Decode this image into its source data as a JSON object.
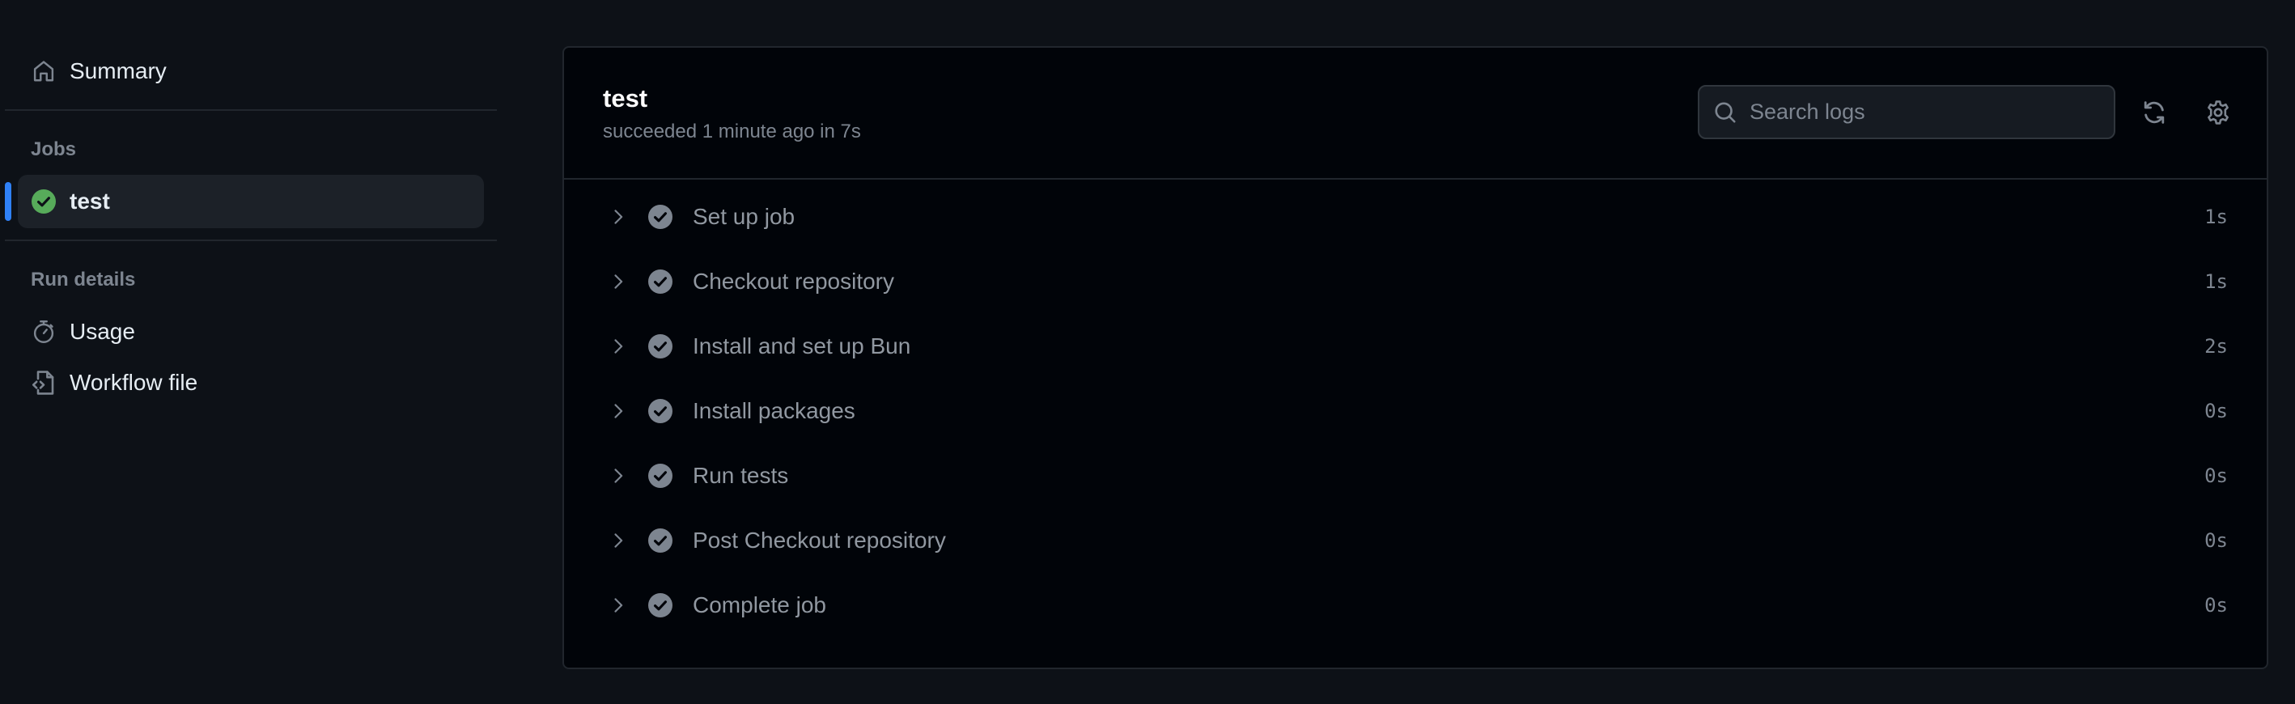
{
  "colors": {
    "page_bg": "#0d1117",
    "panel_bg": "#010409",
    "border": "#21262d",
    "accent_blue": "#2f81f7",
    "success_green": "#57ab5a",
    "muted_text": "#7d8590"
  },
  "sidebar": {
    "summary": {
      "label": "Summary",
      "icon": "home-icon"
    },
    "jobs_heading": "Jobs",
    "jobs": [
      {
        "label": "test",
        "status": "success",
        "icon": "check-circle-fill-icon",
        "selected": true
      }
    ],
    "run_details_heading": "Run details",
    "run_details": [
      {
        "label": "Usage",
        "icon": "stopwatch-icon"
      },
      {
        "label": "Workflow file",
        "icon": "file-code-icon"
      }
    ]
  },
  "job": {
    "title": "test",
    "subtitle": "succeeded 1 minute ago in 7s",
    "search": {
      "placeholder": "Search logs",
      "value": ""
    },
    "actions": {
      "refresh": "refresh-icon",
      "settings": "gear-icon"
    },
    "steps": [
      {
        "name": "Set up job",
        "duration": "1s",
        "status": "success"
      },
      {
        "name": "Checkout repository",
        "duration": "1s",
        "status": "success"
      },
      {
        "name": "Install and set up Bun",
        "duration": "2s",
        "status": "success"
      },
      {
        "name": "Install packages",
        "duration": "0s",
        "status": "success"
      },
      {
        "name": "Run tests",
        "duration": "0s",
        "status": "success"
      },
      {
        "name": "Post Checkout repository",
        "duration": "0s",
        "status": "success"
      },
      {
        "name": "Complete job",
        "duration": "0s",
        "status": "success"
      }
    ]
  }
}
